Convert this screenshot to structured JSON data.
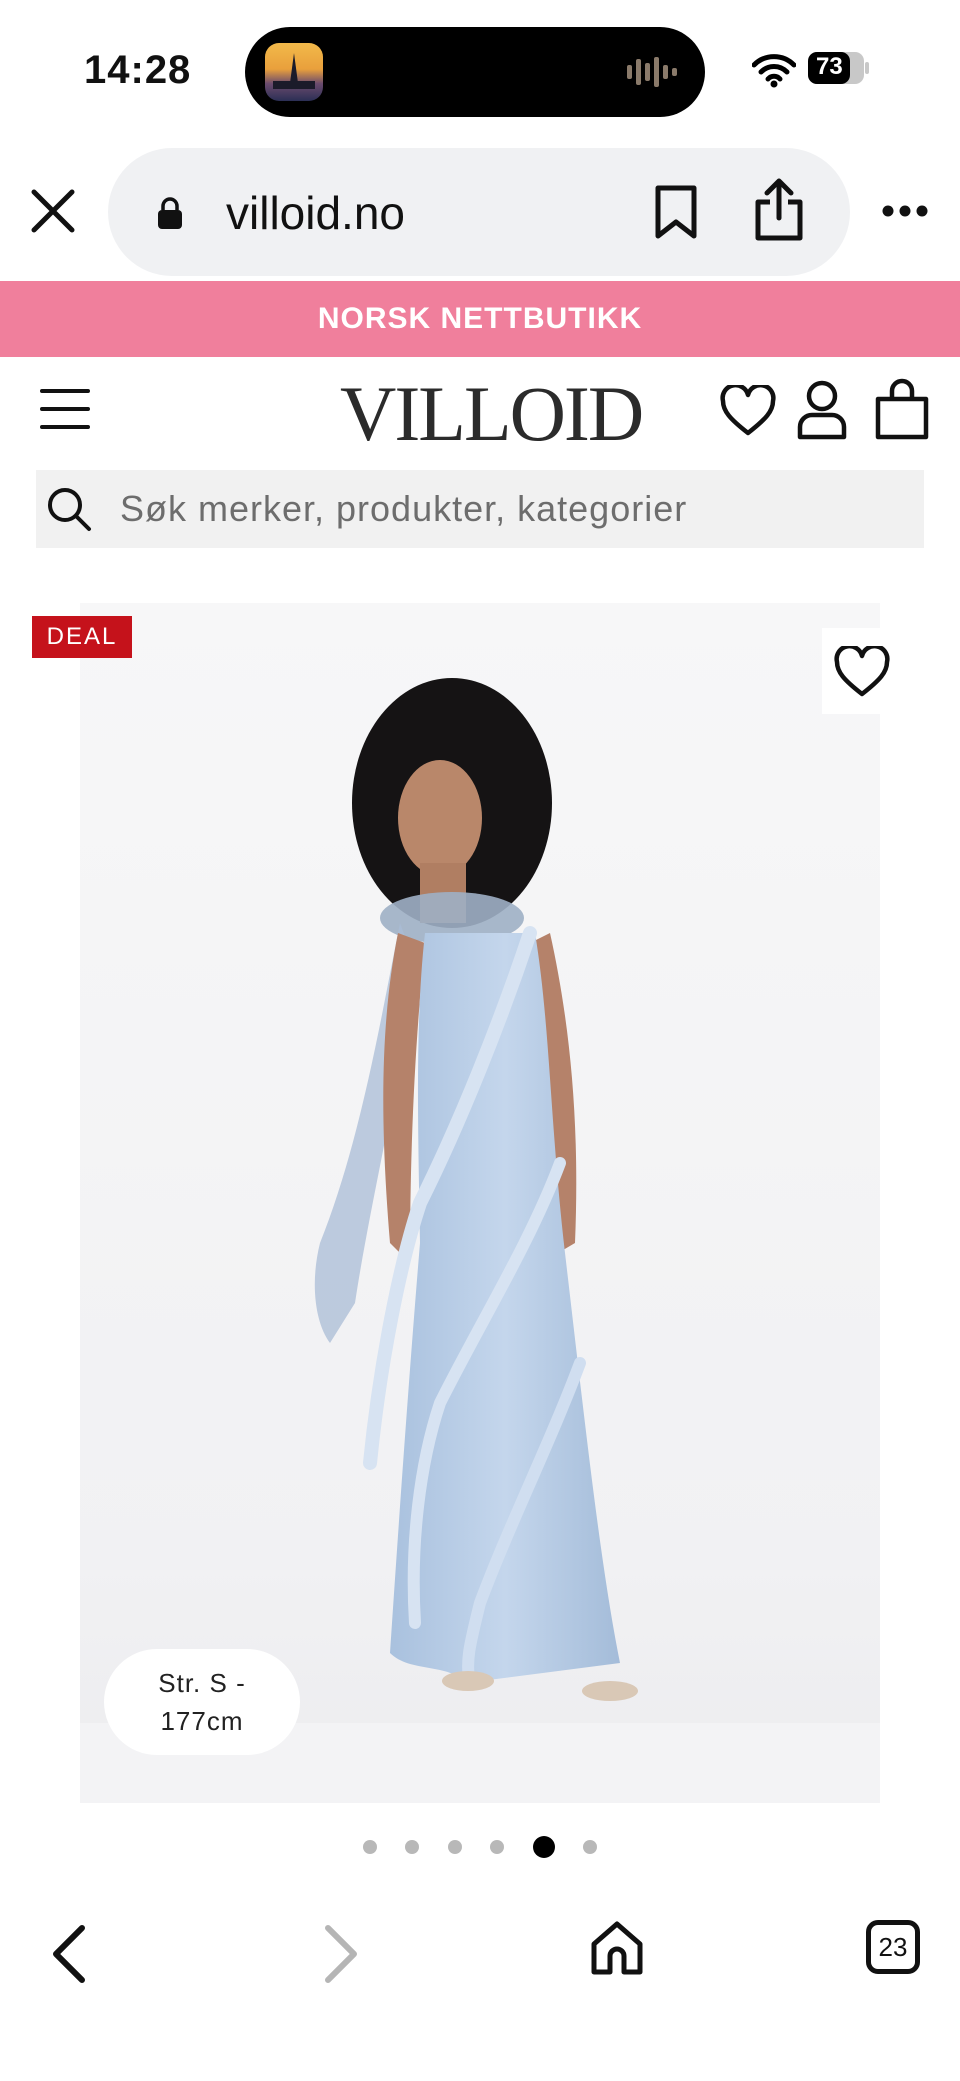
{
  "status_bar": {
    "time": "14:28",
    "battery": "73"
  },
  "browser": {
    "url": "villoid.no"
  },
  "promo_banner": {
    "text": "NORSK NETTBUTIKK"
  },
  "site_header": {
    "logo": "VILLOID"
  },
  "search": {
    "placeholder": "Søk merker, produkter, kategorier"
  },
  "product": {
    "badge": "DEAL",
    "size_info_line1": "Str. S -",
    "size_info_line2": "177cm",
    "gallery_dots_count": 6,
    "gallery_active_index": 4
  },
  "toolbar": {
    "tab_count": "23"
  },
  "colors": {
    "promo": "#f07f9c",
    "deal": "#c5121b",
    "dress": "#b7cde6"
  }
}
